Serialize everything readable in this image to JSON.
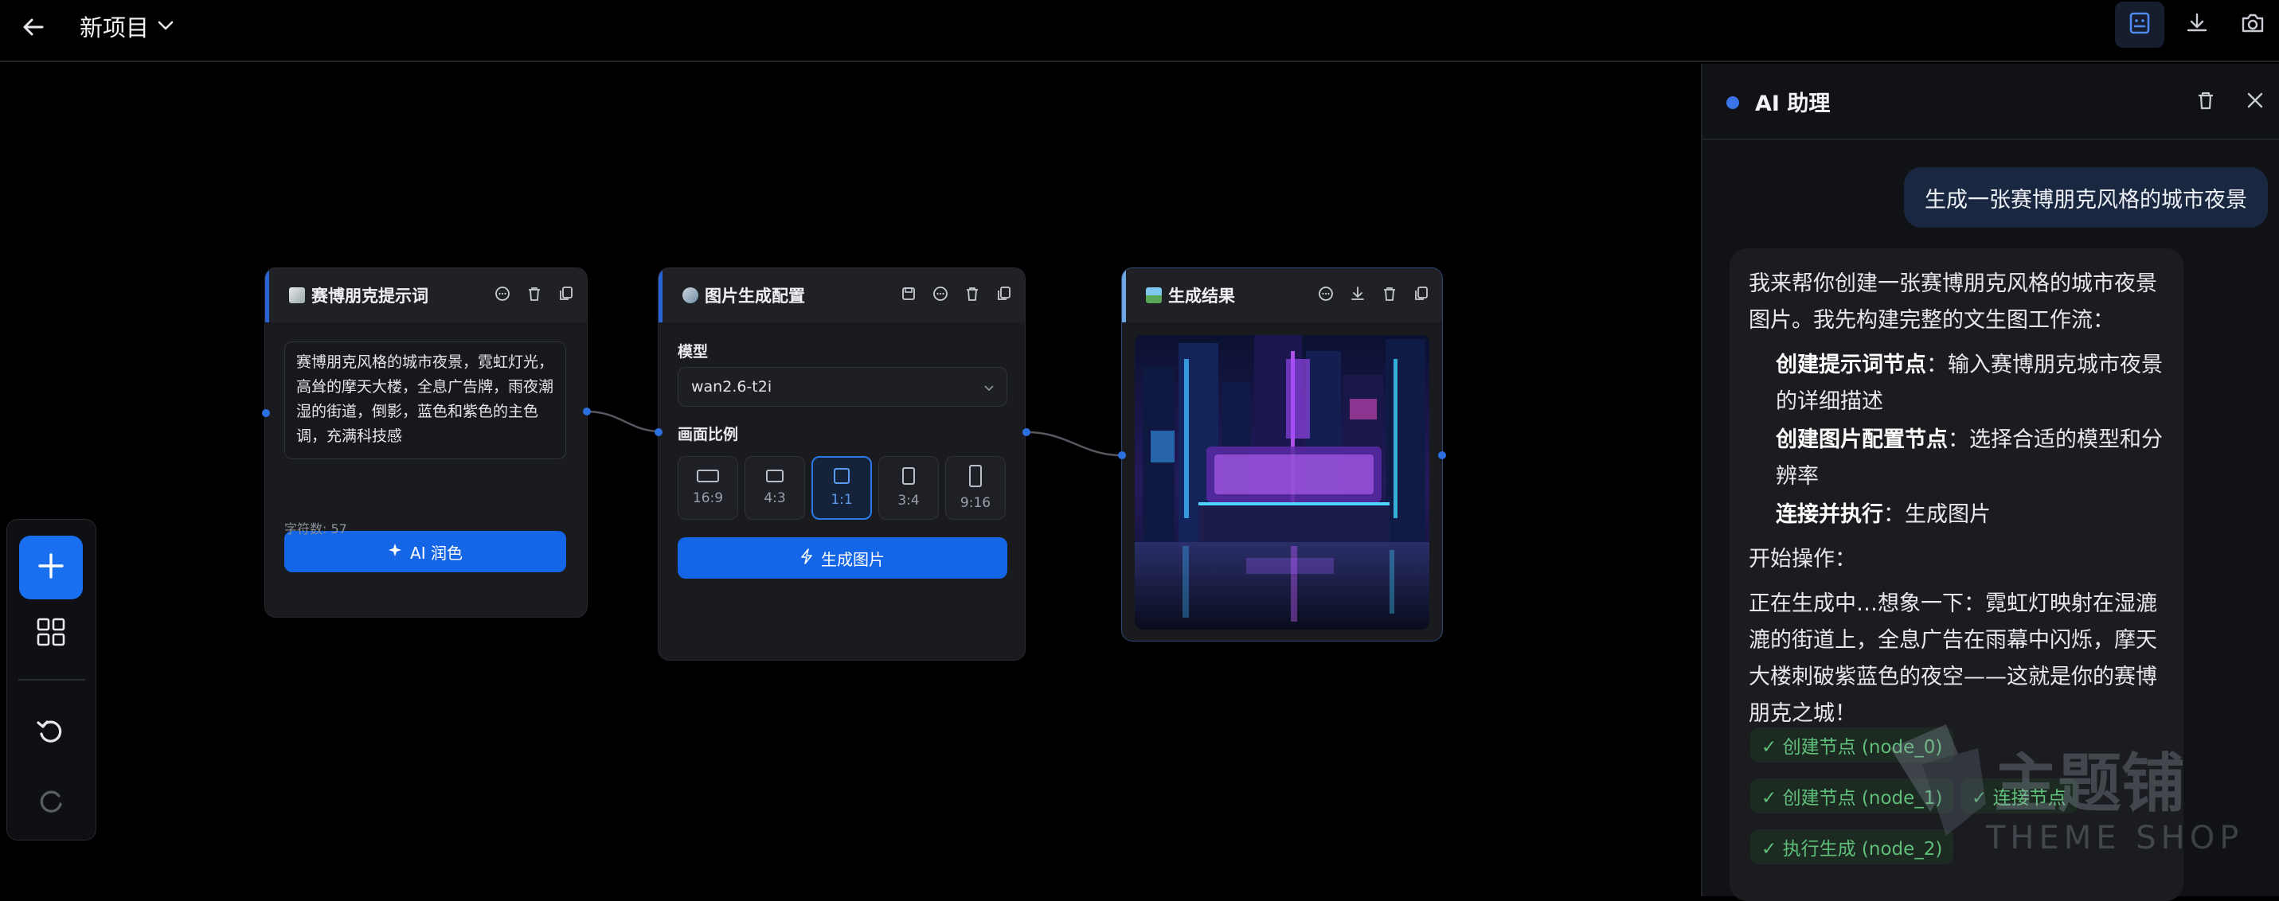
{
  "header": {
    "project_title": "新项目",
    "back_icon": "arrow-left-icon",
    "dropdown_icon": "chevron-down-icon",
    "actions": [
      {
        "icon": "assistant-icon",
        "active": true
      },
      {
        "icon": "download-icon",
        "active": false
      },
      {
        "icon": "camera-icon",
        "active": false
      }
    ]
  },
  "nodes": {
    "prompt": {
      "title": "赛博朋克提示词",
      "text": "赛博朋克风格的城市夜景，霓虹灯光，高耸的摩天大楼，全息广告牌，雨夜潮湿的街道，倒影，蓝色和紫色的主色调，充满科技感",
      "polish_button": "AI 润色",
      "char_count": "字符数: 57"
    },
    "config": {
      "title": "图片生成配置",
      "model_label": "模型",
      "model_value": "wan2.6-t2i",
      "ratio_label": "画面比例",
      "ratios": [
        "16:9",
        "4:3",
        "1:1",
        "3:4",
        "9:16"
      ],
      "selected_ratio": "1:1",
      "generate_button": "生成图片"
    },
    "result": {
      "title": "生成结果"
    }
  },
  "left_toolbar": {
    "items": [
      "plus-icon",
      "grid-icon",
      "undo-icon",
      "redo-icon"
    ]
  },
  "assistant": {
    "title": "AI 助理",
    "user_message": "生成一张赛博朋克风格的城市夜景",
    "intro": "我来帮你创建一张赛博朋克风格的城市夜景图片。我先构建完整的文生图工作流：",
    "steps": [
      {
        "bold": "创建提示词节点",
        "rest": "：输入赛博朋克城市夜景的详细描述"
      },
      {
        "bold": "创建图片配置节点",
        "rest": "：选择合适的模型和分辨率"
      },
      {
        "bold": "连接并执行",
        "rest": "：生成图片"
      }
    ],
    "start": "开始操作：",
    "progress": "正在生成中…想象一下：霓虹灯映射在湿漉漉的街道上，全息广告在雨幕中闪烁，摩天大楼刺破紫蓝色的夜空——这就是你的赛博朋克之城！",
    "tags": [
      "✓ 创建节点 (node_0)",
      "✓ 创建节点 (node_1)",
      "✓ 连接节点",
      "✓ 执行生成 (node_2)"
    ],
    "watermark_main": "主题铺",
    "watermark_sub": "THEME SHOP"
  },
  "colors": {
    "accent": "#1566e6",
    "success": "#5fbf7a",
    "background": "#000000"
  }
}
